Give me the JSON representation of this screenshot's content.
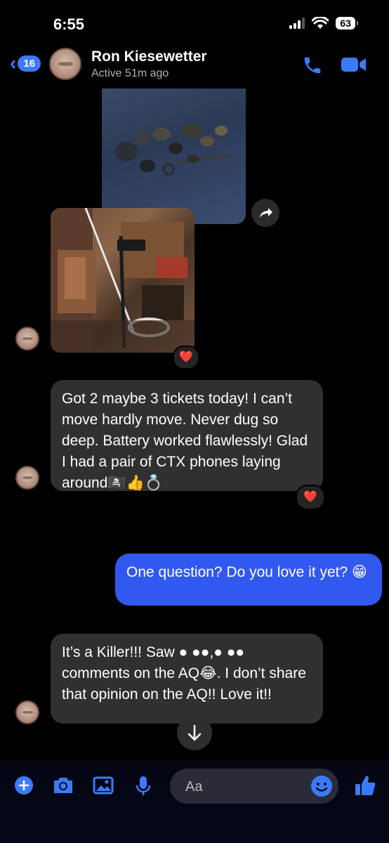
{
  "status_bar": {
    "time": "6:55",
    "battery": "63"
  },
  "header": {
    "back_badge": "16",
    "contact_name": "Ron Kiesewetter",
    "contact_status": "Active 51m ago"
  },
  "messages": [
    {
      "sender": "contact",
      "text": "Got 2 maybe 3 tickets today! I can’t move hardly move. Never dug so deep. Battery worked flawlessly! Glad I had a pair of CTX phones laying around🏴‍☠️👍💍",
      "reaction": "❤️"
    },
    {
      "sender": "me",
      "text": "One question? Do you love it yet? 😁"
    },
    {
      "sender": "contact",
      "text": "It’s a Killer!!! Saw ● ●●,● ●● comments on the AQ😂. I don’t share that opinion on the AQ!! Love it!!"
    }
  ],
  "photo_reaction": "❤️",
  "composer": {
    "placeholder": "Aa"
  },
  "colors": {
    "accent": "#3a7bfd",
    "outgoing_bubble": "#3159f0",
    "incoming_bubble": "#303030"
  }
}
